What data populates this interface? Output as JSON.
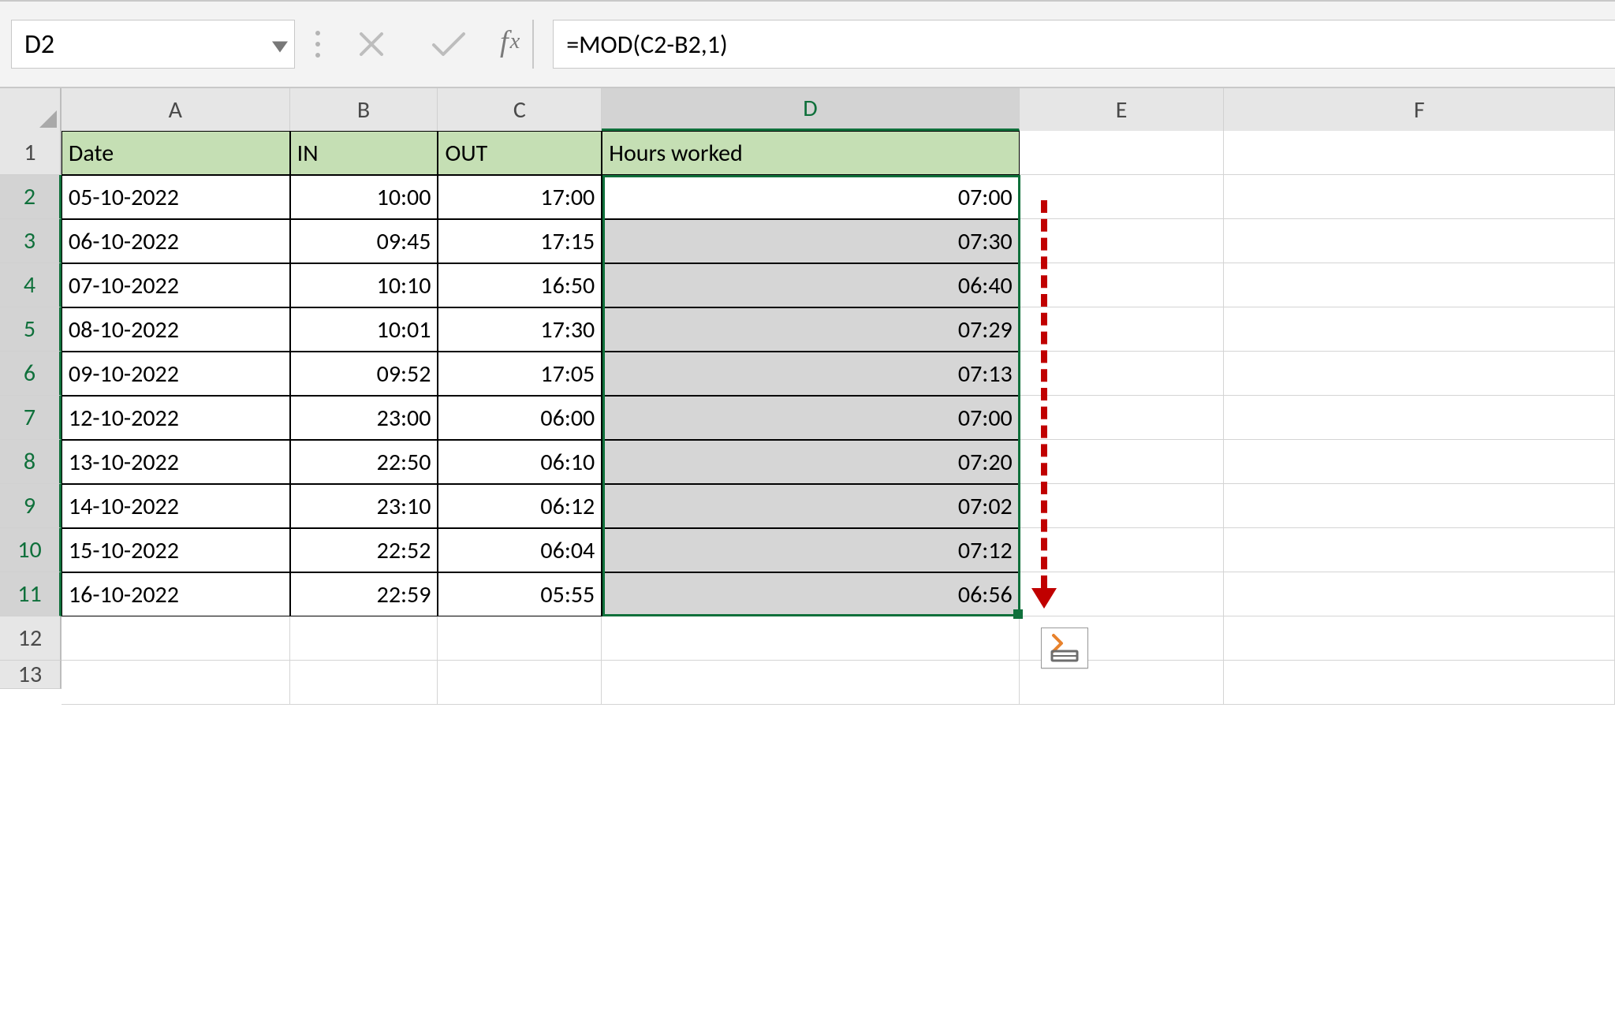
{
  "name_box": "D2",
  "formula_bar": "=MOD(C2-B2,1)",
  "fx_label": "fx",
  "col_headers": [
    "A",
    "B",
    "C",
    "D",
    "E",
    "F"
  ],
  "selected_col": "D",
  "header_row": {
    "A": "Date",
    "B": "IN",
    "C": "OUT",
    "D": "Hours worked"
  },
  "rows": [
    {
      "n": "1"
    },
    {
      "n": "2",
      "A": "05-10-2022",
      "B": "10:00",
      "C": "17:00",
      "D": "07:00"
    },
    {
      "n": "3",
      "A": "06-10-2022",
      "B": "09:45",
      "C": "17:15",
      "D": "07:30"
    },
    {
      "n": "4",
      "A": "07-10-2022",
      "B": "10:10",
      "C": "16:50",
      "D": "06:40"
    },
    {
      "n": "5",
      "A": "08-10-2022",
      "B": "10:01",
      "C": "17:30",
      "D": "07:29"
    },
    {
      "n": "6",
      "A": "09-10-2022",
      "B": "09:52",
      "C": "17:05",
      "D": "07:13"
    },
    {
      "n": "7",
      "A": "12-10-2022",
      "B": "23:00",
      "C": "06:00",
      "D": "07:00"
    },
    {
      "n": "8",
      "A": "13-10-2022",
      "B": "22:50",
      "C": "06:10",
      "D": "07:20"
    },
    {
      "n": "9",
      "A": "14-10-2022",
      "B": "23:10",
      "C": "06:12",
      "D": "07:02"
    },
    {
      "n": "10",
      "A": "15-10-2022",
      "B": "22:52",
      "C": "06:04",
      "D": "07:12"
    },
    {
      "n": "11",
      "A": "16-10-2022",
      "B": "22:59",
      "C": "05:55",
      "D": "06:56"
    },
    {
      "n": "12"
    },
    {
      "n": "13"
    }
  ],
  "selected_rows": [
    "2",
    "3",
    "4",
    "5",
    "6",
    "7",
    "8",
    "9",
    "10",
    "11"
  ],
  "active_cell_row": "2"
}
